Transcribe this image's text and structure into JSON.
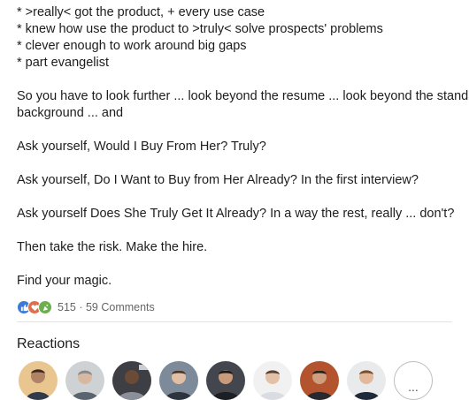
{
  "post": {
    "lines": [
      "* >really< got the product, + every use case",
      "* knew how use the product to >truly< solve prospects' problems",
      "* clever enough to work around big gaps",
      "* part evangelist",
      "So you have to look further ... look beyond the resume ... look beyond the standard",
      "background ... and",
      "Ask yourself, Would I Buy From Her?  Truly?",
      "Ask yourself, Do I Want to Buy from Her Already?  In the first interview?",
      "Ask yourself Does She Truly Get It Already?  In a way the rest, really ... don't?",
      "Then take the risk.  Make the hire.",
      "Find your magic."
    ]
  },
  "social": {
    "reaction_icons": [
      "like-icon",
      "love-icon",
      "celebrate-icon"
    ],
    "reaction_count": "515",
    "separator": " · ",
    "comments": "59 Comments"
  },
  "reactions": {
    "title": "Reactions",
    "more_label": "..."
  },
  "colors": {
    "like": "#3b7ad9",
    "love": "#df704d",
    "celebrate": "#6dae4f"
  }
}
